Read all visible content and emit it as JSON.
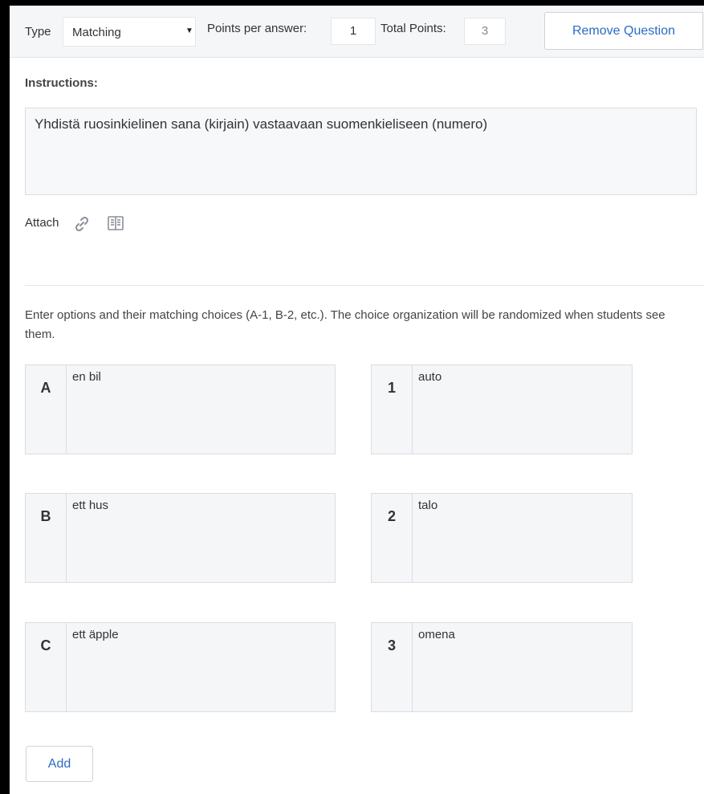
{
  "header": {
    "type_label": "Type",
    "type_value": "Matching",
    "points_per_answer_label": "Points per answer:",
    "points_per_answer_value": "1",
    "total_points_label": "Total Points:",
    "total_points_value": "3",
    "remove_button": "Remove Question"
  },
  "instructions": {
    "label": "Instructions:",
    "text": "Yhdistä ruosinkielinen sana (kirjain) vastaavaan suomenkieliseen (numero)"
  },
  "attach": {
    "label": "Attach",
    "icons": [
      "link-icon",
      "book-icon"
    ]
  },
  "help_text": "Enter options and their matching choices (A-1, B-2, etc.). The choice organization will be randomized when students see them.",
  "pairs": [
    {
      "option_key": "A",
      "option_text": "en bil",
      "choice_key": "1",
      "choice_text": "auto"
    },
    {
      "option_key": "B",
      "option_text": "ett hus",
      "choice_key": "2",
      "choice_text": "talo"
    },
    {
      "option_key": "C",
      "option_text": "ett äpple",
      "choice_key": "3",
      "choice_text": "omena"
    }
  ],
  "add_button": "Add",
  "colors": {
    "link_blue": "#2b6cc4",
    "panel_bg": "#f5f6f8",
    "border": "#dadde2"
  }
}
